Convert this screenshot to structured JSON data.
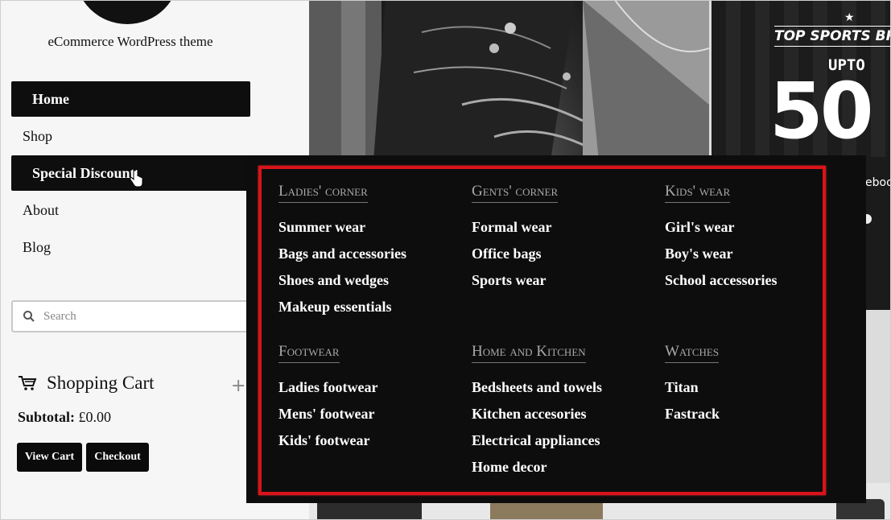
{
  "site": {
    "tagline": "eCommerce WordPress theme"
  },
  "nav": {
    "items": [
      {
        "label": "Home"
      },
      {
        "label": "Shop"
      },
      {
        "label": "Special Discount"
      },
      {
        "label": "About"
      },
      {
        "label": "Blog"
      }
    ]
  },
  "search": {
    "placeholder": "Search"
  },
  "cart": {
    "title": "Shopping Cart",
    "plus": "+",
    "subtotal_label": "Subtotal:",
    "subtotal_value": "£0.00",
    "view_cart": "View Cart",
    "checkout": "Checkout"
  },
  "promo": {
    "headline": "TOP SPORTS BRA",
    "upto": "UPTO",
    "percent": "50",
    "social": "ebook"
  },
  "mega_menu": {
    "columns": [
      {
        "title": "Ladies' corner",
        "links": [
          "Summer wear",
          "Bags and accessories",
          "Shoes and wedges",
          "Makeup essentials"
        ]
      },
      {
        "title": "Gents' corner",
        "links": [
          "Formal wear",
          "Office bags",
          "Sports wear"
        ]
      },
      {
        "title": "Kids' wear",
        "links": [
          "Girl's wear",
          "Boy's wear",
          "School accessories"
        ]
      },
      {
        "title": "Footwear",
        "links": [
          "Ladies footwear",
          "Mens' footwear",
          "Kids' footwear"
        ]
      },
      {
        "title": "Home and Kitchen",
        "links": [
          "Bedsheets and towels",
          "Kitchen accesories",
          "Electrical appliances",
          "Home decor"
        ]
      },
      {
        "title": "Watches",
        "links": [
          "Titan",
          "Fastrack"
        ]
      }
    ],
    "highlight_color": "#d8141a"
  }
}
